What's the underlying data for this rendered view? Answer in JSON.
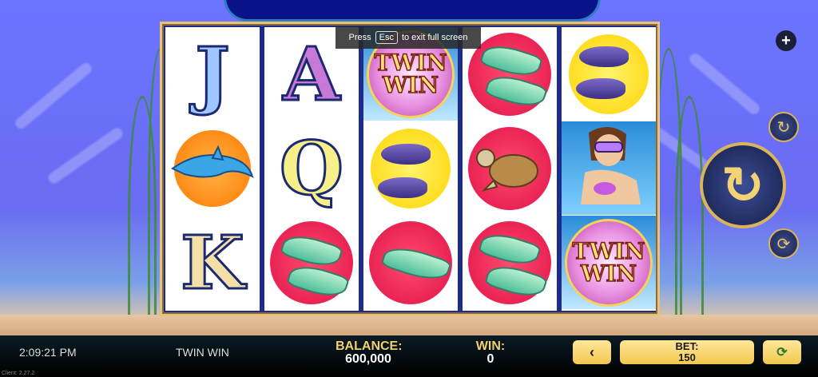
{
  "game_title": "TWIN WIN",
  "fullscreen_tip": {
    "prefix": "Press",
    "key": "Esc",
    "suffix": "to exit full screen"
  },
  "reels": [
    [
      "J",
      "dolphin",
      "K"
    ],
    [
      "A",
      "Q",
      "manta-ray"
    ],
    [
      "twin-win",
      "seal",
      "manta-ray"
    ],
    [
      "manta-ray",
      "turtle",
      "manta-ray"
    ],
    [
      "seal",
      "diver",
      "twin-win"
    ]
  ],
  "logo_text": {
    "line1": "TWIN",
    "line2": "WIN"
  },
  "status_bar": {
    "time": "2:09:21 PM",
    "game_name": "TWIN WIN",
    "balance_label": "BALANCE:",
    "balance_value": "600,000",
    "win_label": "WIN:",
    "win_value": "0",
    "bet_label": "BET:",
    "bet_value": "150",
    "client_version": "Client: 2.27.2"
  },
  "colors": {
    "accent_gold": "#f0d06a",
    "frame_blue": "#1d2c8a"
  },
  "icons": [
    "plus-icon",
    "autoplay-icon",
    "spin-arrow-icon",
    "turbo-icon",
    "chevron-left-icon",
    "refresh-icon"
  ]
}
